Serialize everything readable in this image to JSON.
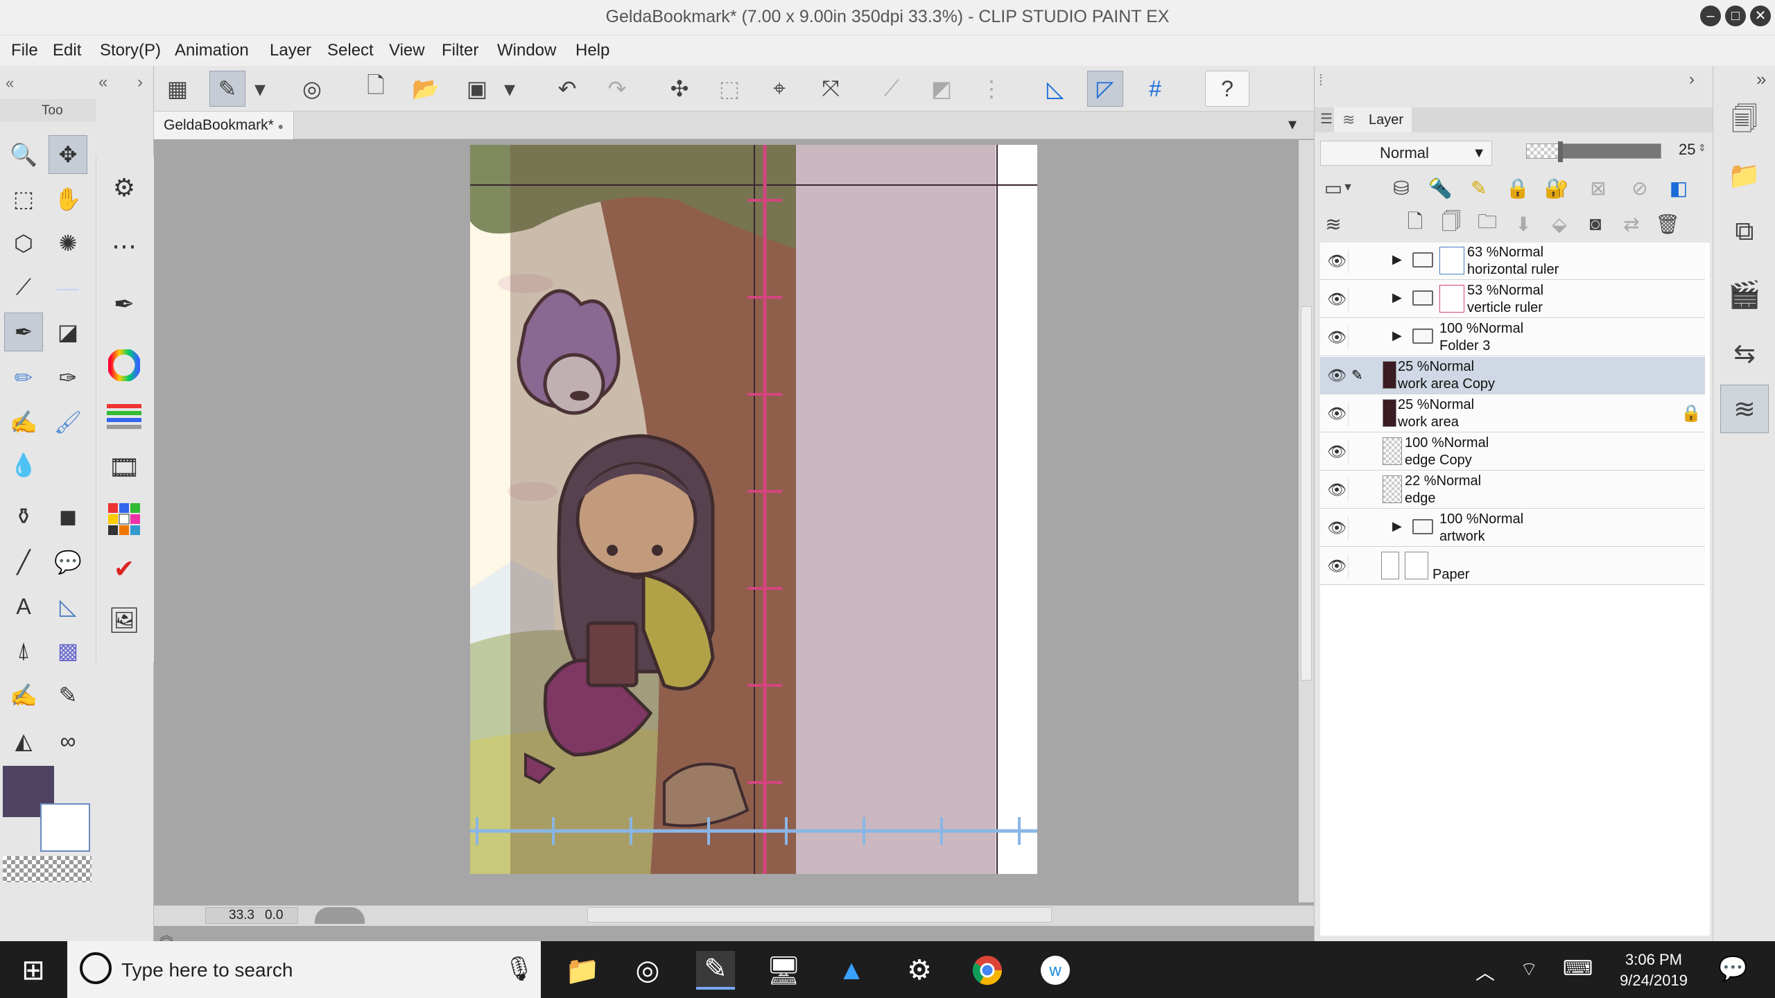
{
  "window": {
    "title": "GeldaBookmark* (7.00 x 9.00in 350dpi 33.3%)  - CLIP STUDIO PAINT EX",
    "minimize": "–",
    "maximize": "□",
    "close": "✕"
  },
  "menu": [
    "File",
    "Edit",
    "Story(P)",
    "Animation",
    "Layer",
    "Select",
    "View",
    "Filter",
    "Window",
    "Help"
  ],
  "tool_panel": {
    "title": "Too"
  },
  "document": {
    "tab": "GeldaBookmark*",
    "zoom": "33.3",
    "rotation": "0.0"
  },
  "layer_panel": {
    "tab": "Layer",
    "blend_mode": "Normal",
    "opacity": 25,
    "opacity_display": "25",
    "layers": [
      {
        "opacity": "63 %Normal",
        "name": "horizontal ruler",
        "type": "folder",
        "selected": false,
        "locked": false
      },
      {
        "opacity": "53 %Normal",
        "name": "verticle ruler",
        "type": "folder",
        "selected": false,
        "locked": false
      },
      {
        "opacity": "100 %Normal",
        "name": "Folder 3",
        "type": "folder",
        "selected": false,
        "locked": false
      },
      {
        "opacity": "25 %Normal",
        "name": "work area Copy",
        "type": "raster",
        "selected": true,
        "locked": false
      },
      {
        "opacity": "25 %Normal",
        "name": "work area",
        "type": "raster",
        "selected": false,
        "locked": true
      },
      {
        "opacity": "100 %Normal",
        "name": "edge Copy",
        "type": "raster",
        "selected": false,
        "locked": false
      },
      {
        "opacity": "22 %Normal",
        "name": "edge",
        "type": "raster",
        "selected": false,
        "locked": false
      },
      {
        "opacity": "100 %Normal",
        "name": "artwork",
        "type": "folder",
        "selected": false,
        "locked": false
      },
      {
        "opacity": "",
        "name": "Paper",
        "type": "paper",
        "selected": false,
        "locked": false
      }
    ]
  },
  "colors": {
    "main": "#4e4362",
    "sub": "#ffffff",
    "accent": "#79a7ff",
    "ruler_pink": "#d4457e",
    "ruler_blue": "#8ab6e6"
  },
  "taskbar": {
    "search_placeholder": "Type here to search",
    "time": "3:06 PM",
    "date": "9/24/2019"
  }
}
